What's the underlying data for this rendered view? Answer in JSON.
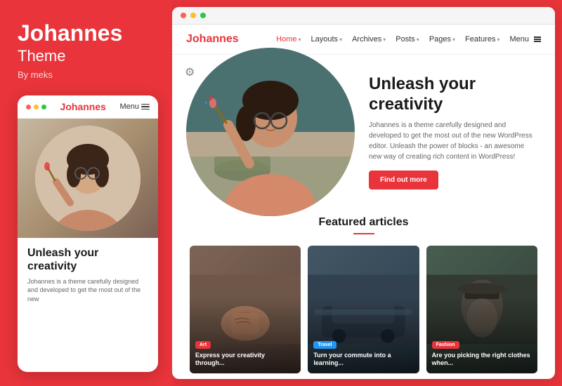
{
  "left": {
    "title": "Johannes",
    "subtitle": "Theme",
    "by": "By meks",
    "mobile": {
      "logo": "Johannes",
      "menu_label": "Menu",
      "hero_title": "Unleash your creativity",
      "hero_desc": "Johannes is a theme carefully designed and developed to get the most out of the new"
    }
  },
  "browser": {
    "nav": {
      "logo": "Johannes",
      "items": [
        {
          "label": "Home",
          "active": true,
          "has_chevron": true
        },
        {
          "label": "Layouts",
          "active": false,
          "has_chevron": true
        },
        {
          "label": "Archives",
          "active": false,
          "has_chevron": true
        },
        {
          "label": "Posts",
          "active": false,
          "has_chevron": true
        },
        {
          "label": "Pages",
          "active": false,
          "has_chevron": true
        },
        {
          "label": "Features",
          "active": false,
          "has_chevron": true
        },
        {
          "label": "Menu",
          "active": false,
          "has_chevron": true
        }
      ]
    },
    "hero": {
      "title_line1": "Unleash your",
      "title_line2": "creativity",
      "description": "Johannes is a theme carefully designed and developed to get the most out of the new WordPress editor. Unleash the power of blocks - an awesome new way of creating rich content in WordPress!",
      "cta_label": "Find out more"
    },
    "featured": {
      "section_title": "Featured articles"
    },
    "articles": [
      {
        "tag": "Art",
        "tag_class": "tag-art",
        "card_class": "card-bg-1",
        "title": "Express your creativity through..."
      },
      {
        "tag": "Travel",
        "tag_class": "tag-travel",
        "card_class": "card-bg-2",
        "title": "Turn your commute into a learning..."
      },
      {
        "tag": "Fashion",
        "tag_class": "tag-fashion",
        "card_class": "card-bg-3",
        "title": "Are you picking the right clothes when..."
      }
    ]
  },
  "colors": {
    "brand_red": "#e8343a"
  }
}
